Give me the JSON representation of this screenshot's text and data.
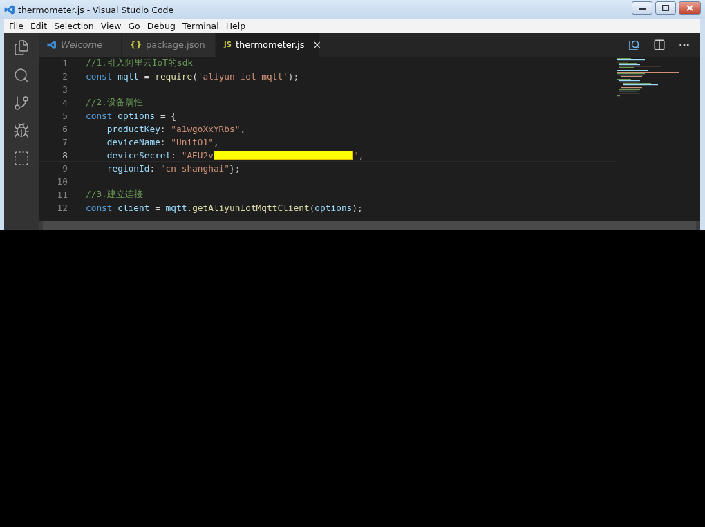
{
  "window": {
    "title": "thermometer.js - Visual Studio Code"
  },
  "menu": [
    "File",
    "Edit",
    "Selection",
    "View",
    "Go",
    "Debug",
    "Terminal",
    "Help"
  ],
  "tabs": [
    {
      "label": "Welcome",
      "kind": "welcome",
      "selected": false
    },
    {
      "label": "package.json",
      "kind": "json",
      "badge": "{}",
      "selected": false
    },
    {
      "label": "thermometer.js",
      "kind": "js",
      "badge": "JS",
      "selected": true,
      "close": "×"
    }
  ],
  "editor": {
    "lines": [
      {
        "number": "1",
        "current": false,
        "tokens": [
          {
            "kind": "comment",
            "text": "//1.引入阿里云IoT的sdk"
          }
        ]
      },
      {
        "number": "2",
        "current": false,
        "tokens": [
          {
            "kind": "keyword",
            "text": "const "
          },
          {
            "kind": "variable",
            "text": "mqtt"
          },
          {
            "kind": "punct",
            "text": " = "
          },
          {
            "kind": "func",
            "text": "require"
          },
          {
            "kind": "punct",
            "text": "("
          },
          {
            "kind": "string",
            "text": "'aliyun-iot-mqtt'"
          },
          {
            "kind": "punct",
            "text": ");"
          }
        ]
      },
      {
        "number": "3",
        "current": false
      },
      {
        "number": "4",
        "current": false,
        "tokens": [
          {
            "kind": "comment",
            "text": "//2.设备属性"
          }
        ]
      },
      {
        "number": "5",
        "current": false,
        "tokens": [
          {
            "kind": "keyword",
            "text": "const "
          },
          {
            "kind": "variable",
            "text": "options"
          },
          {
            "kind": "punct",
            "text": " = {"
          }
        ]
      },
      {
        "number": "6",
        "current": false,
        "tokens": [
          {
            "kind": "indent"
          },
          {
            "kind": "variable",
            "text": "productKey"
          },
          {
            "kind": "punct",
            "text": ": "
          },
          {
            "kind": "string",
            "text": "\"a1wgoXxYRbs\""
          },
          {
            "kind": "punct",
            "text": ","
          }
        ]
      },
      {
        "number": "7",
        "current": false,
        "tokens": [
          {
            "kind": "indent"
          },
          {
            "kind": "variable",
            "text": "deviceName"
          },
          {
            "kind": "punct",
            "text": ": "
          },
          {
            "kind": "string",
            "text": "\"Unit01\""
          },
          {
            "kind": "punct",
            "text": ","
          }
        ]
      },
      {
        "number": "8",
        "current": true,
        "tokens": [
          {
            "kind": "indent"
          },
          {
            "kind": "variable",
            "text": "deviceSecret"
          },
          {
            "kind": "punct",
            "text": ": "
          },
          {
            "kind": "string",
            "text": "\"AEU2v"
          },
          {
            "kind": "redaction"
          },
          {
            "kind": "string",
            "text": "\""
          },
          {
            "kind": "punct",
            "text": ","
          }
        ]
      },
      {
        "number": "9",
        "current": false,
        "tokens": [
          {
            "kind": "indent"
          },
          {
            "kind": "variable",
            "text": "regionId"
          },
          {
            "kind": "punct",
            "text": ": "
          },
          {
            "kind": "string",
            "text": "\"cn-shanghai\""
          },
          {
            "kind": "punct",
            "text": "};"
          }
        ]
      },
      {
        "number": "10",
        "current": false
      },
      {
        "number": "11",
        "current": false,
        "tokens": [
          {
            "kind": "comment",
            "text": "//3.建立连接"
          }
        ]
      },
      {
        "number": "12",
        "current": false,
        "tokens": [
          {
            "kind": "keyword",
            "text": "const "
          },
          {
            "kind": "variable",
            "text": "client"
          },
          {
            "kind": "punct",
            "text": " = "
          },
          {
            "kind": "variable",
            "text": "mqtt"
          },
          {
            "kind": "punct",
            "text": "."
          },
          {
            "kind": "func",
            "text": "getAliyunIotMqttClient"
          },
          {
            "kind": "punct",
            "text": "("
          },
          {
            "kind": "variable",
            "text": "options"
          },
          {
            "kind": "punct",
            "text": ");"
          }
        ]
      }
    ]
  }
}
